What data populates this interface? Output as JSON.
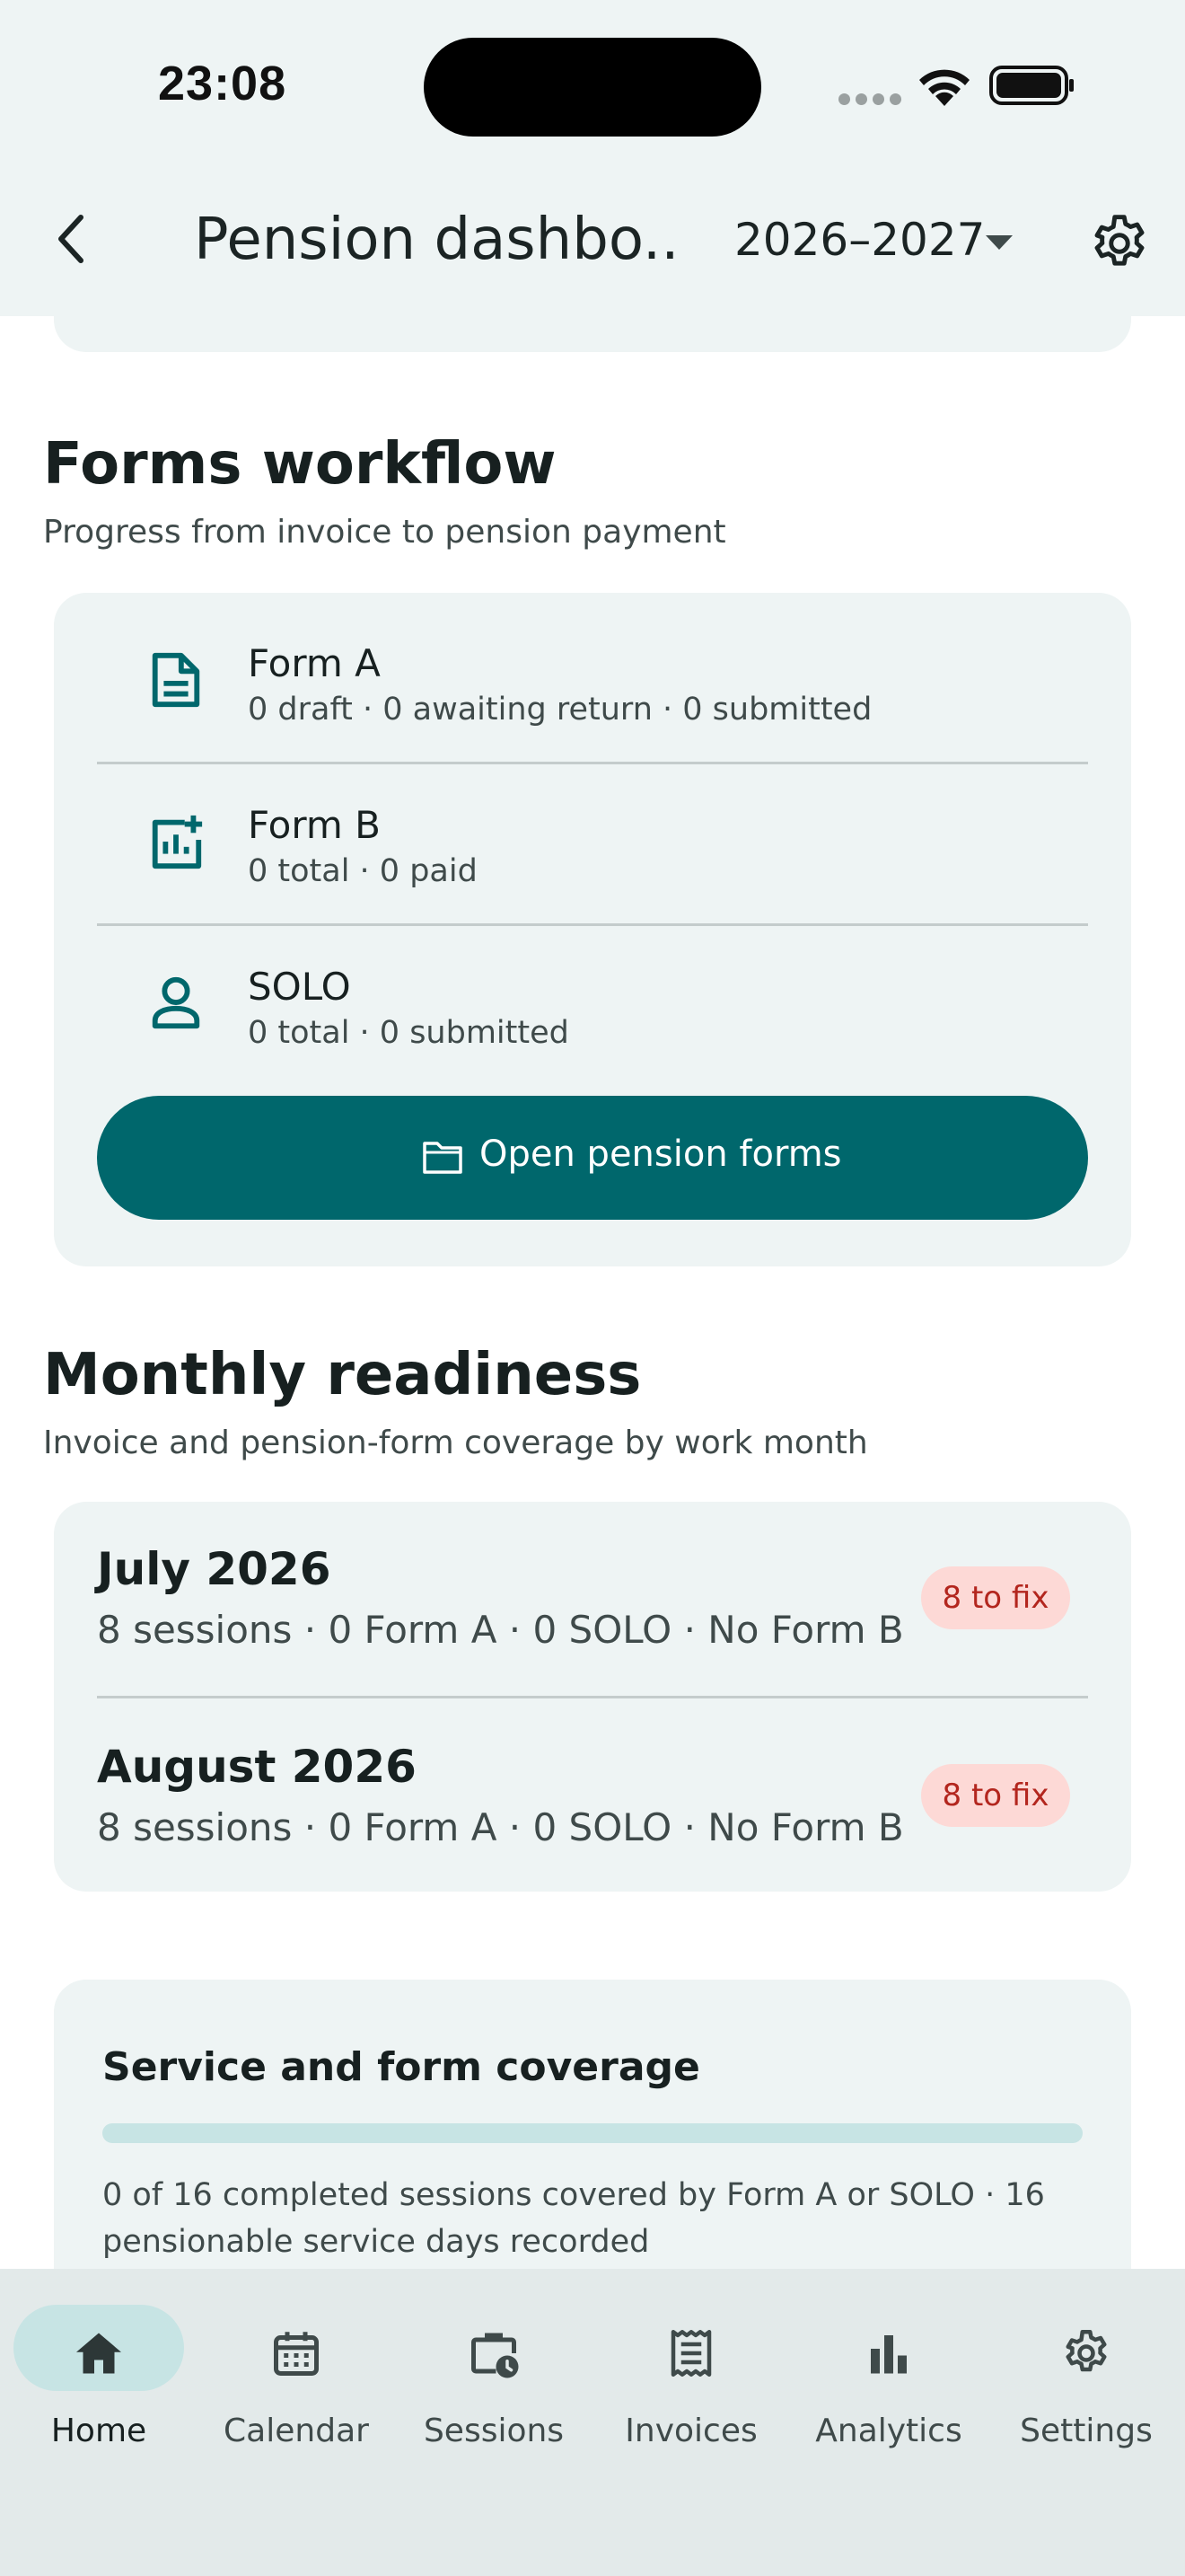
{
  "status_bar": {
    "time": "23:08"
  },
  "header": {
    "title": "Pension dashbo...",
    "year": "2026–2027",
    "back_icon": "chevron-left-icon",
    "settings_icon": "gear-icon"
  },
  "forms_workflow": {
    "title": "Forms workflow",
    "subtitle": "Progress from invoice to pension payment",
    "rows": [
      {
        "icon": "document-icon",
        "title": "Form A",
        "summary": "0 draft · 0 awaiting return · 0 submitted"
      },
      {
        "icon": "chart-add-icon",
        "title": "Form B",
        "summary": "0 total · 0 paid"
      },
      {
        "icon": "person-icon",
        "title": "SOLO",
        "summary": "0 total · 0 submitted"
      }
    ],
    "button_label": "Open pension forms",
    "button_icon": "folder-icon"
  },
  "monthly_readiness": {
    "title": "Monthly readiness",
    "subtitle": "Invoice and pension-form coverage by work month",
    "months": [
      {
        "title": "July 2026",
        "summary": "8 sessions · 0 Form A · 0 SOLO · No Form B",
        "badge": "8 to fix"
      },
      {
        "title": "August 2026",
        "summary": "8 sessions · 0 Form A · 0 SOLO · No Form B",
        "badge": "8 to fix"
      }
    ]
  },
  "coverage": {
    "title": "Service and form coverage",
    "progress_fraction": 0,
    "description": "0 of 16 completed sessions covered by Form A or SOLO · 16 pensionable service days recorded"
  },
  "bottom_nav": {
    "active": "Home",
    "items": [
      {
        "label": "Home",
        "icon": "home-icon"
      },
      {
        "label": "Calendar",
        "icon": "calendar-icon"
      },
      {
        "label": "Sessions",
        "icon": "briefcase-clock-icon"
      },
      {
        "label": "Invoices",
        "icon": "receipt-icon"
      },
      {
        "label": "Analytics",
        "icon": "bar-chart-icon"
      },
      {
        "label": "Settings",
        "icon": "gear-icon"
      }
    ]
  },
  "colors": {
    "primary": "#00676c",
    "surface": "#eef4f4",
    "badge_bg": "#fdd9d6",
    "badge_text": "#b3261e",
    "nav_bg": "#e3eaea",
    "nav_active_pill": "#c7e4e4"
  }
}
